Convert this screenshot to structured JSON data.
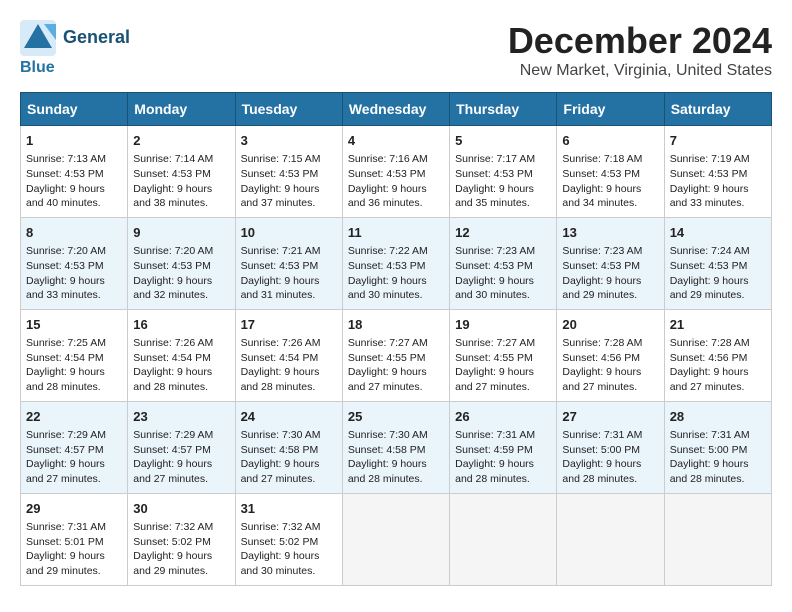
{
  "logo": {
    "line1": "General",
    "line2": "Blue"
  },
  "title": "December 2024",
  "subtitle": "New Market, Virginia, United States",
  "days_of_week": [
    "Sunday",
    "Monday",
    "Tuesday",
    "Wednesday",
    "Thursday",
    "Friday",
    "Saturday"
  ],
  "weeks": [
    [
      {
        "day": "1",
        "sunrise": "7:13 AM",
        "sunset": "4:53 PM",
        "daylight": "9 hours and 40 minutes."
      },
      {
        "day": "2",
        "sunrise": "7:14 AM",
        "sunset": "4:53 PM",
        "daylight": "9 hours and 38 minutes."
      },
      {
        "day": "3",
        "sunrise": "7:15 AM",
        "sunset": "4:53 PM",
        "daylight": "9 hours and 37 minutes."
      },
      {
        "day": "4",
        "sunrise": "7:16 AM",
        "sunset": "4:53 PM",
        "daylight": "9 hours and 36 minutes."
      },
      {
        "day": "5",
        "sunrise": "7:17 AM",
        "sunset": "4:53 PM",
        "daylight": "9 hours and 35 minutes."
      },
      {
        "day": "6",
        "sunrise": "7:18 AM",
        "sunset": "4:53 PM",
        "daylight": "9 hours and 34 minutes."
      },
      {
        "day": "7",
        "sunrise": "7:19 AM",
        "sunset": "4:53 PM",
        "daylight": "9 hours and 33 minutes."
      }
    ],
    [
      {
        "day": "8",
        "sunrise": "7:20 AM",
        "sunset": "4:53 PM",
        "daylight": "9 hours and 33 minutes."
      },
      {
        "day": "9",
        "sunrise": "7:20 AM",
        "sunset": "4:53 PM",
        "daylight": "9 hours and 32 minutes."
      },
      {
        "day": "10",
        "sunrise": "7:21 AM",
        "sunset": "4:53 PM",
        "daylight": "9 hours and 31 minutes."
      },
      {
        "day": "11",
        "sunrise": "7:22 AM",
        "sunset": "4:53 PM",
        "daylight": "9 hours and 30 minutes."
      },
      {
        "day": "12",
        "sunrise": "7:23 AM",
        "sunset": "4:53 PM",
        "daylight": "9 hours and 30 minutes."
      },
      {
        "day": "13",
        "sunrise": "7:23 AM",
        "sunset": "4:53 PM",
        "daylight": "9 hours and 29 minutes."
      },
      {
        "day": "14",
        "sunrise": "7:24 AM",
        "sunset": "4:53 PM",
        "daylight": "9 hours and 29 minutes."
      }
    ],
    [
      {
        "day": "15",
        "sunrise": "7:25 AM",
        "sunset": "4:54 PM",
        "daylight": "9 hours and 28 minutes."
      },
      {
        "day": "16",
        "sunrise": "7:26 AM",
        "sunset": "4:54 PM",
        "daylight": "9 hours and 28 minutes."
      },
      {
        "day": "17",
        "sunrise": "7:26 AM",
        "sunset": "4:54 PM",
        "daylight": "9 hours and 28 minutes."
      },
      {
        "day": "18",
        "sunrise": "7:27 AM",
        "sunset": "4:55 PM",
        "daylight": "9 hours and 27 minutes."
      },
      {
        "day": "19",
        "sunrise": "7:27 AM",
        "sunset": "4:55 PM",
        "daylight": "9 hours and 27 minutes."
      },
      {
        "day": "20",
        "sunrise": "7:28 AM",
        "sunset": "4:56 PM",
        "daylight": "9 hours and 27 minutes."
      },
      {
        "day": "21",
        "sunrise": "7:28 AM",
        "sunset": "4:56 PM",
        "daylight": "9 hours and 27 minutes."
      }
    ],
    [
      {
        "day": "22",
        "sunrise": "7:29 AM",
        "sunset": "4:57 PM",
        "daylight": "9 hours and 27 minutes."
      },
      {
        "day": "23",
        "sunrise": "7:29 AM",
        "sunset": "4:57 PM",
        "daylight": "9 hours and 27 minutes."
      },
      {
        "day": "24",
        "sunrise": "7:30 AM",
        "sunset": "4:58 PM",
        "daylight": "9 hours and 27 minutes."
      },
      {
        "day": "25",
        "sunrise": "7:30 AM",
        "sunset": "4:58 PM",
        "daylight": "9 hours and 28 minutes."
      },
      {
        "day": "26",
        "sunrise": "7:31 AM",
        "sunset": "4:59 PM",
        "daylight": "9 hours and 28 minutes."
      },
      {
        "day": "27",
        "sunrise": "7:31 AM",
        "sunset": "5:00 PM",
        "daylight": "9 hours and 28 minutes."
      },
      {
        "day": "28",
        "sunrise": "7:31 AM",
        "sunset": "5:00 PM",
        "daylight": "9 hours and 28 minutes."
      }
    ],
    [
      {
        "day": "29",
        "sunrise": "7:31 AM",
        "sunset": "5:01 PM",
        "daylight": "9 hours and 29 minutes."
      },
      {
        "day": "30",
        "sunrise": "7:32 AM",
        "sunset": "5:02 PM",
        "daylight": "9 hours and 29 minutes."
      },
      {
        "day": "31",
        "sunrise": "7:32 AM",
        "sunset": "5:02 PM",
        "daylight": "9 hours and 30 minutes."
      },
      null,
      null,
      null,
      null
    ]
  ],
  "labels": {
    "sunrise": "Sunrise:",
    "sunset": "Sunset:",
    "daylight": "Daylight:"
  }
}
